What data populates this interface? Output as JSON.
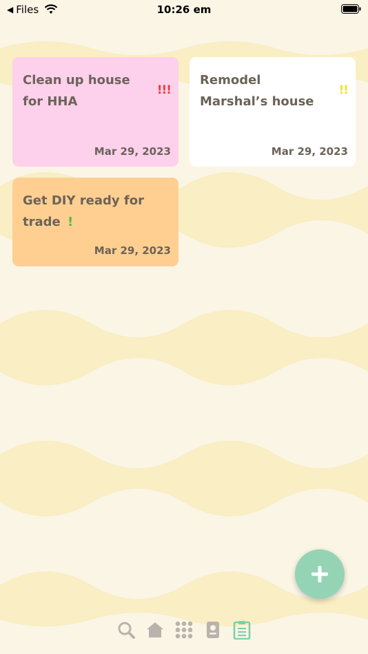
{
  "status_bar": {
    "back_app": "Files",
    "time": "10:26 em"
  },
  "todos": [
    {
      "title": "Clean up house for HHA",
      "priority": "!!!",
      "priority_color": "#ef3b3b",
      "date": "Mar 29, 2023",
      "color": "#fdd0ec"
    },
    {
      "title": "Remodel Marshal’s house",
      "priority": "!!",
      "priority_color": "#f2e22a",
      "date": "Mar 29, 2023",
      "color": "#ffffff"
    },
    {
      "title": "Get DIY ready for trade",
      "priority": "!",
      "priority_color": "#4fb84a",
      "date": "Mar 29, 2023",
      "color": "#ffcf91"
    }
  ],
  "add_button": {
    "icon": "plus-icon",
    "color": "#94d4b5"
  },
  "tab_bar": {
    "tabs": [
      {
        "icon": "search-icon",
        "active": false
      },
      {
        "icon": "home-icon",
        "active": false
      },
      {
        "icon": "grid-icon",
        "active": false
      },
      {
        "icon": "passport-icon",
        "active": false
      },
      {
        "icon": "clipboard-icon",
        "active": true
      }
    ],
    "active_color": "#7ccfa8",
    "inactive_color": "#b8b4ab"
  }
}
